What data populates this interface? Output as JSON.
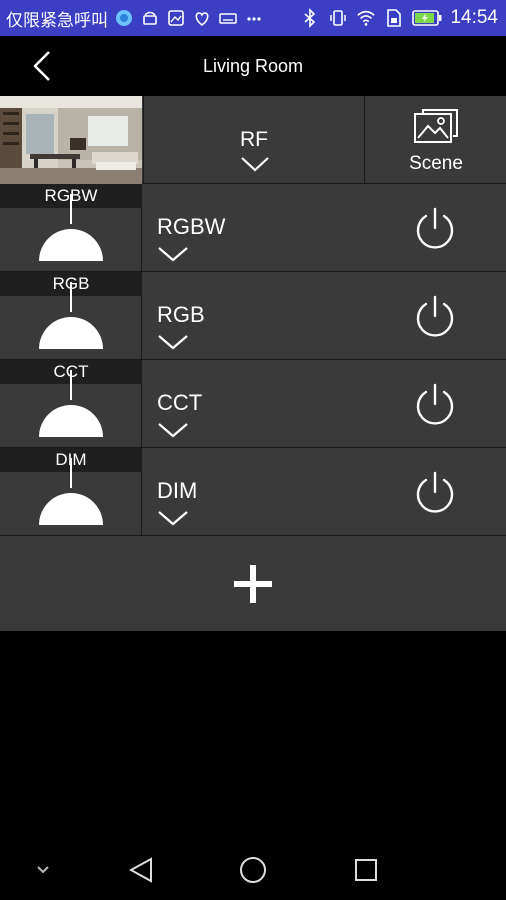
{
  "status_bar": {
    "notification_text": "仅限紧急呼叫",
    "time": "14:54",
    "bar_color": "#3b3fc4"
  },
  "header": {
    "title": "Living Room",
    "back_icon": "chevron-left-icon"
  },
  "controller": {
    "mode_label": "RF",
    "scene_label": "Scene"
  },
  "devices": [
    {
      "type": "RGBW",
      "name": "RGBW"
    },
    {
      "type": "RGB",
      "name": "RGB"
    },
    {
      "type": "CCT",
      "name": "CCT"
    },
    {
      "type": "DIM",
      "name": "DIM"
    }
  ],
  "add_icon": "plus-icon",
  "colors": {
    "panel": "#3a3a3a",
    "type_bar": "#1f1f1f",
    "background": "#000000"
  }
}
